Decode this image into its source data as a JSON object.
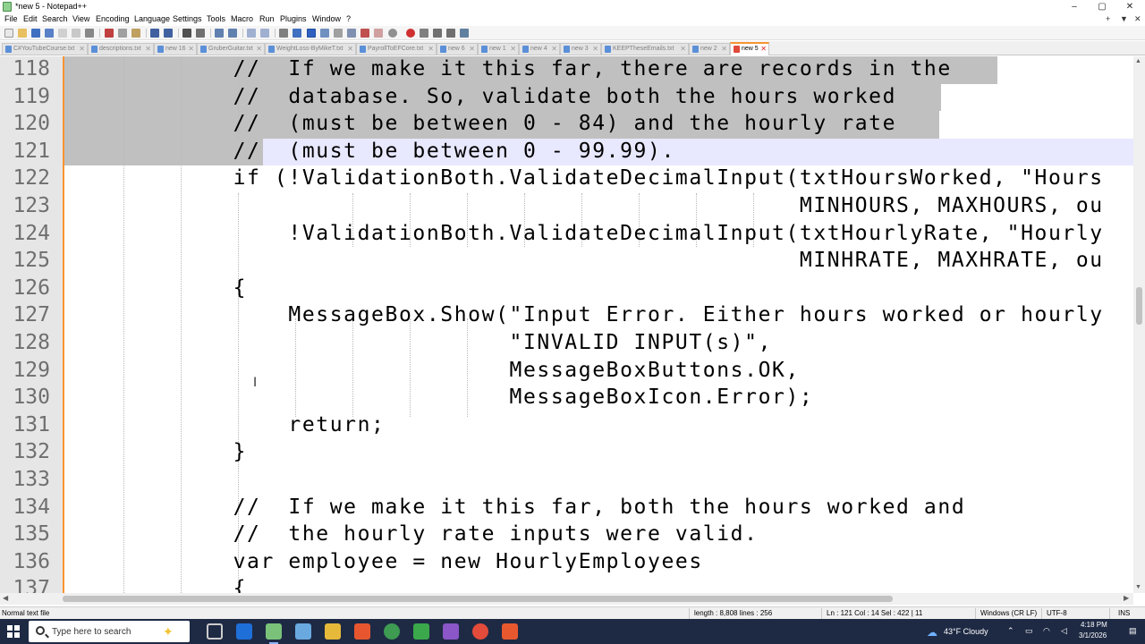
{
  "window": {
    "title": "*new 5 - Notepad++",
    "controls": [
      "–",
      "▢",
      "✕"
    ]
  },
  "menu": {
    "items": [
      "File",
      "Edit",
      "Search",
      "View",
      "Encoding",
      "Language",
      "Settings",
      "Tools",
      "Macro",
      "Run",
      "Plugins",
      "Window",
      "?"
    ],
    "right_controls": [
      "+",
      "▼",
      "✕"
    ]
  },
  "tabs": [
    {
      "label": "C#YouTubeCourse.txt",
      "active": false
    },
    {
      "label": "descriptions.txt",
      "active": false
    },
    {
      "label": "new 16",
      "active": false
    },
    {
      "label": "GruberGuitar.txt",
      "active": false
    },
    {
      "label": "WeightLoss-ByMikeT.txt",
      "active": false
    },
    {
      "label": "PayrollToEFCore.txt",
      "active": false
    },
    {
      "label": "new 6",
      "active": false
    },
    {
      "label": "new 1",
      "active": false
    },
    {
      "label": "new 4",
      "active": false
    },
    {
      "label": "new 3",
      "active": false
    },
    {
      "label": "KEEPTheseEmails.txt",
      "active": false
    },
    {
      "label": "new 2",
      "active": false
    },
    {
      "label": "new 5",
      "active": true
    }
  ],
  "editor": {
    "lines": [
      {
        "num": "118",
        "text": "        //  If we make it this far, there are records in the"
      },
      {
        "num": "119",
        "text": "        //  database. So, validate both the hours worked"
      },
      {
        "num": "120",
        "text": "        //  (must be between 0 - 84) and the hourly rate"
      },
      {
        "num": "121",
        "text": "        //  (must be between 0 - 99.99)."
      },
      {
        "num": "122",
        "text": "        if (!ValidationBoth.ValidateDecimalInput(txtHoursWorked, \"Hours"
      },
      {
        "num": "123",
        "text": "                                                 MINHOURS, MAXHOURS, ou"
      },
      {
        "num": "124",
        "text": "            !ValidationBoth.ValidateDecimalInput(txtHourlyRate, \"Hourly"
      },
      {
        "num": "125",
        "text": "                                                 MINHRATE, MAXHRATE, ou"
      },
      {
        "num": "126",
        "text": "        {"
      },
      {
        "num": "127",
        "text": "            MessageBox.Show(\"Input Error. Either hours worked or hourly"
      },
      {
        "num": "128",
        "text": "                            \"INVALID INPUT(s)\","
      },
      {
        "num": "129",
        "text": "                            MessageBoxButtons.OK,"
      },
      {
        "num": "130",
        "text": "                            MessageBoxIcon.Error);"
      },
      {
        "num": "131",
        "text": "            return;"
      },
      {
        "num": "132",
        "text": "        }"
      },
      {
        "num": "133",
        "text": ""
      },
      {
        "num": "134",
        "text": "        //  If we make it this far, both the hours worked and"
      },
      {
        "num": "135",
        "text": "        //  the hourly rate inputs were valid."
      },
      {
        "num": "136",
        "text": "        var employee = new HourlyEmployees"
      },
      {
        "num": "137",
        "text": "        {"
      }
    ]
  },
  "statusbar": {
    "file_type": "Normal text file",
    "length": "length : 8,808    lines : 256",
    "position": "Ln : 121    Col : 14    Sel : 422 | 11",
    "eol": "Windows (CR LF)",
    "encoding": "UTF-8",
    "mode": "INS"
  },
  "taskbar": {
    "search_placeholder": "Type here to search",
    "weather": "43°F  Cloudy",
    "time": "4:18 PM",
    "date": "3/1/2026"
  }
}
